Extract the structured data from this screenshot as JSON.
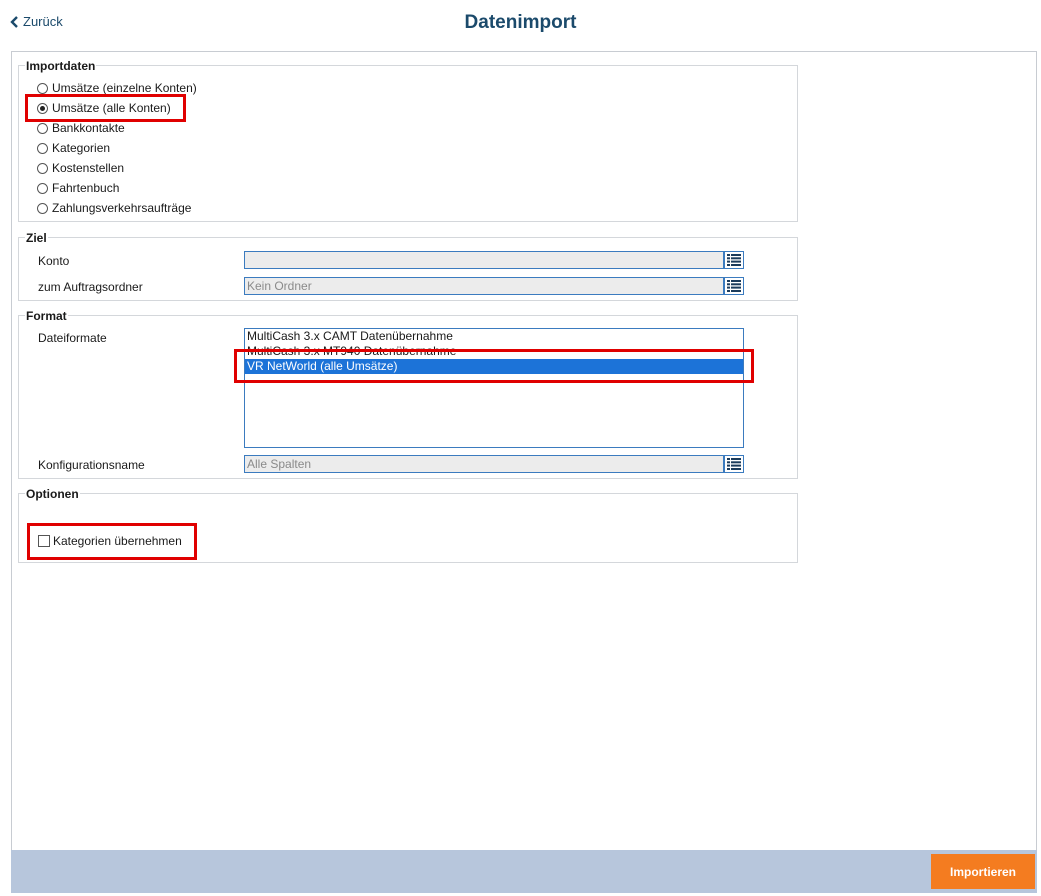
{
  "header": {
    "back_label": "Zurück",
    "title": "Datenimport"
  },
  "importdaten": {
    "legend": "Importdaten",
    "options": [
      {
        "label": "Umsätze (einzelne Konten)",
        "checked": false
      },
      {
        "label": "Umsätze (alle Konten)",
        "checked": true
      },
      {
        "label": "Bankkontakte",
        "checked": false
      },
      {
        "label": "Kategorien",
        "checked": false
      },
      {
        "label": "Kostenstellen",
        "checked": false
      },
      {
        "label": "Fahrtenbuch",
        "checked": false
      },
      {
        "label": "Zahlungsverkehrsaufträge",
        "checked": false
      }
    ]
  },
  "ziel": {
    "legend": "Ziel",
    "konto_label": "Konto",
    "konto_value": "",
    "ordner_label": "zum Auftragsordner",
    "ordner_value": "Kein Ordner"
  },
  "format": {
    "legend": "Format",
    "dateiformate_label": "Dateiformate",
    "dateiformate": [
      "MultiCash 3.x CAMT Datenübernahme",
      "MultiCash 3.x MT940 Datenübernahme",
      "VR NetWorld (alle Umsätze)"
    ],
    "selected_index": 2,
    "konfig_label": "Konfigurationsname",
    "konfig_value": "Alle Spalten"
  },
  "optionen": {
    "legend": "Optionen",
    "kategorien_label": "Kategorien übernehmen",
    "kategorien_checked": false
  },
  "footer": {
    "import_label": "Importieren"
  },
  "colors": {
    "title": "#1b4a6b",
    "selection": "#1c73d8",
    "highlight_box": "#e00000",
    "footer_bar": "#b7c6dc",
    "import_button": "#f47c20"
  }
}
